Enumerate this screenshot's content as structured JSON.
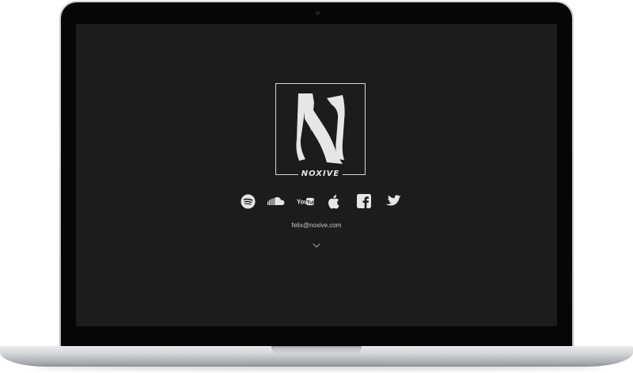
{
  "brand": {
    "wordmark": "NOXIVE",
    "logo_letter": "N"
  },
  "social_links": [
    {
      "icon": "spotify-icon"
    },
    {
      "icon": "soundcloud-icon"
    },
    {
      "icon": "youtube-icon",
      "label": "You Tube"
    },
    {
      "icon": "apple-icon"
    },
    {
      "icon": "facebook-icon"
    },
    {
      "icon": "twitter-icon"
    }
  ],
  "contact": {
    "email": "felix@noxive.com"
  },
  "scroll_hint": {
    "icon": "chevron-down-icon"
  },
  "colors": {
    "screen_background": "#1c1c1c",
    "foreground": "#e6e6e6",
    "bezel": "#060606"
  }
}
